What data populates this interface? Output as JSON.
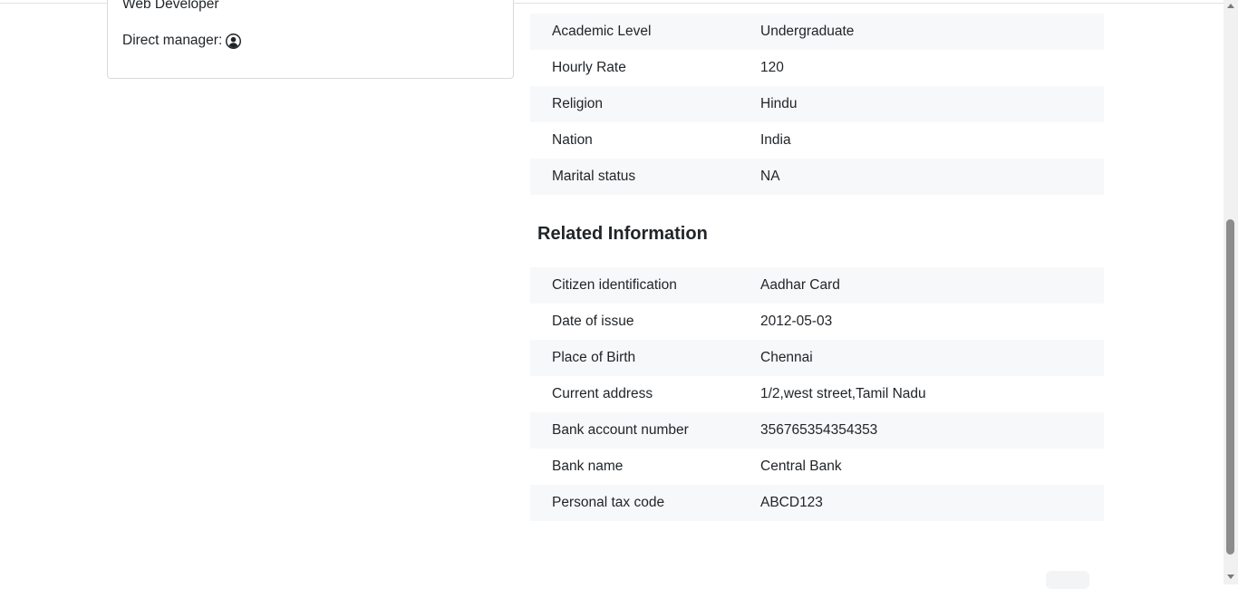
{
  "profile_card": {
    "job_title": "Web Developer",
    "direct_manager_label": "Direct manager:",
    "manager_icon": "user-circle-icon"
  },
  "personal_info": {
    "rows": [
      {
        "label": "Academic Level",
        "value": "Undergraduate"
      },
      {
        "label": "Hourly Rate",
        "value": "120"
      },
      {
        "label": "Religion",
        "value": "Hindu"
      },
      {
        "label": "Nation",
        "value": "India"
      },
      {
        "label": "Marital status",
        "value": "NA"
      }
    ]
  },
  "related_info": {
    "title": "Related Information",
    "rows": [
      {
        "label": "Citizen identification",
        "value": "Aadhar Card"
      },
      {
        "label": "Date of issue",
        "value": "2012-05-03"
      },
      {
        "label": "Place of Birth",
        "value": "Chennai"
      },
      {
        "label": "Current address",
        "value": "1/2,west street,Tamil Nadu"
      },
      {
        "label": "Bank account number",
        "value": "356765354354353"
      },
      {
        "label": "Bank name",
        "value": "Central Bank"
      },
      {
        "label": "Personal tax code",
        "value": "ABCD123"
      }
    ]
  },
  "colors": {
    "stripe": "#f7f8f9",
    "border": "#d7dadd",
    "text": "#212529"
  }
}
